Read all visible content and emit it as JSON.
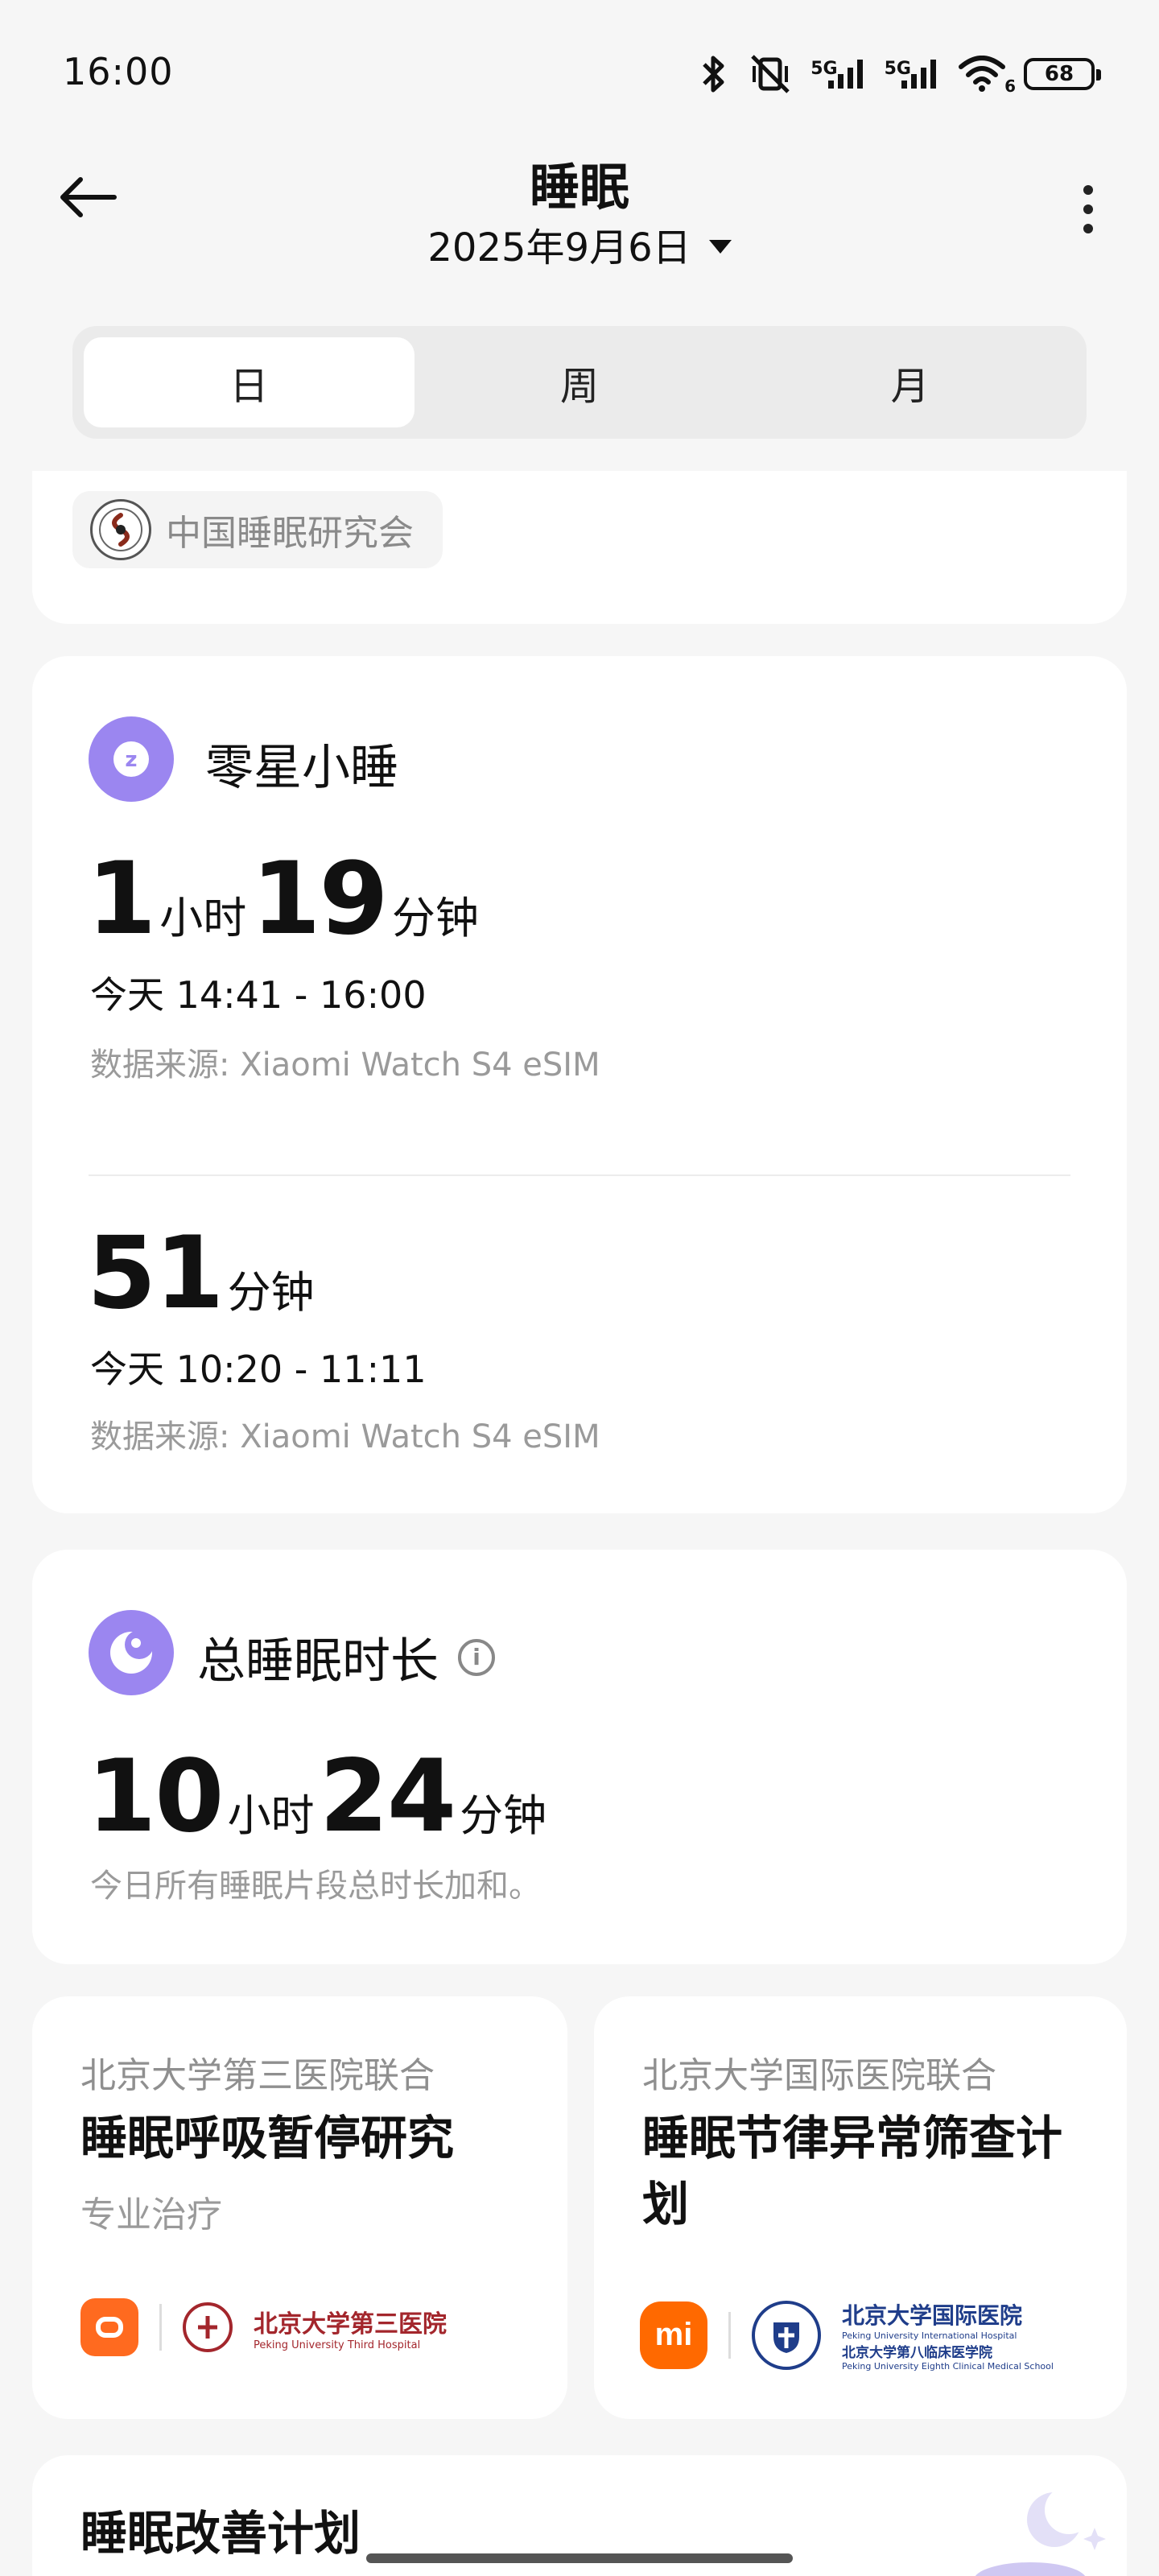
{
  "status_bar": {
    "time": "16:00",
    "network_1": "5G",
    "network_2": "5G",
    "wifi_badge": "6",
    "battery": "68"
  },
  "header": {
    "title": "睡眠",
    "date": "2025年9月6日"
  },
  "tabs": [
    {
      "label": "日",
      "active": true
    },
    {
      "label": "周",
      "active": false
    },
    {
      "label": "月",
      "active": false
    }
  ],
  "org": {
    "name": "中国睡眠研究会"
  },
  "nap": {
    "title": "零星小睡",
    "sessions": [
      {
        "hours": "1",
        "hours_unit": "小时",
        "minutes": "19",
        "minutes_unit": "分钟",
        "time_range": "今天 14:41 - 16:00",
        "source": "数据来源: Xiaomi Watch S4 eSIM"
      },
      {
        "minutes": "51",
        "minutes_unit": "分钟",
        "time_range": "今天 10:20 - 11:11",
        "source": "数据来源: Xiaomi Watch S4 eSIM"
      }
    ]
  },
  "total": {
    "title": "总睡眠时长",
    "hours": "10",
    "hours_unit": "小时",
    "minutes": "24",
    "minutes_unit": "分钟",
    "description": "今日所有睡眠片段总时长加和。"
  },
  "promos": [
    {
      "subtitle": "北京大学第三医院联合",
      "title": "睡眠呼吸暂停研究",
      "note": "专业治疗",
      "logo_hospital": "北京大学第三医院",
      "logo_hospital_en": "Peking University Third Hospital"
    },
    {
      "subtitle": "北京大学国际医院联合",
      "title": "睡眠节律异常筛查计划",
      "logo_brand": "mi",
      "logo_hospital": "北京大学国际医院",
      "logo_hospital_en": "Peking University International Hospital",
      "logo_hospital_2": "北京大学第八临床医学院",
      "logo_hospital_2_en": "Peking University Eighth Clinical Medical School"
    }
  ],
  "plan": {
    "title": "睡眠改善计划"
  },
  "colors": {
    "accent": "#9b86f0",
    "background": "#f6f6f6",
    "card": "#ffffff",
    "muted_text": "#9a9a9a"
  }
}
